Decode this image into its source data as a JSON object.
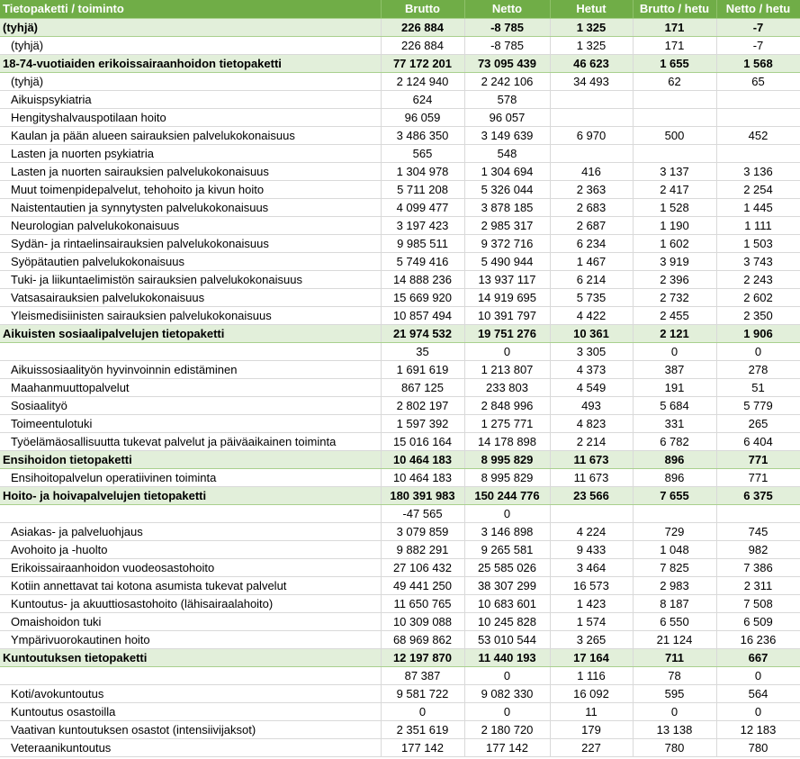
{
  "headers": [
    "Tietopaketti / toiminto",
    "Brutto",
    "Netto",
    "Hetut",
    "Brutto / hetu",
    "Netto / hetu"
  ],
  "rows": [
    {
      "group": true,
      "cells": [
        "(tyhjä)",
        "226 884",
        "-8 785",
        "1 325",
        "171",
        "-7"
      ]
    },
    {
      "group": false,
      "cells": [
        "(tyhjä)",
        "226 884",
        "-8 785",
        "1 325",
        "171",
        "-7"
      ]
    },
    {
      "group": true,
      "cells": [
        "18-74-vuotiaiden erikoissairaanhoidon tietopaketti",
        "77 172 201",
        "73 095 439",
        "46 623",
        "1 655",
        "1 568"
      ]
    },
    {
      "group": false,
      "cells": [
        "(tyhjä)",
        "2 124 940",
        "2 242 106",
        "34 493",
        "62",
        "65"
      ]
    },
    {
      "group": false,
      "cells": [
        "Aikuispsykiatria",
        "624",
        "578",
        "",
        "",
        ""
      ]
    },
    {
      "group": false,
      "cells": [
        "Hengityshalvauspotilaan hoito",
        "96 059",
        "96 057",
        "",
        "",
        ""
      ]
    },
    {
      "group": false,
      "cells": [
        "Kaulan ja pään alueen sairauksien palvelukokonaisuus",
        "3 486 350",
        "3 149 639",
        "6 970",
        "500",
        "452"
      ]
    },
    {
      "group": false,
      "cells": [
        "Lasten ja nuorten psykiatria",
        "565",
        "548",
        "",
        "",
        ""
      ]
    },
    {
      "group": false,
      "cells": [
        "Lasten ja nuorten sairauksien palvelukokonaisuus",
        "1 304 978",
        "1 304 694",
        "416",
        "3 137",
        "3 136"
      ]
    },
    {
      "group": false,
      "cells": [
        "Muut toimenpidepalvelut, tehohoito ja kivun hoito",
        "5 711 208",
        "5 326 044",
        "2 363",
        "2 417",
        "2 254"
      ]
    },
    {
      "group": false,
      "cells": [
        "Naistentautien ja synnytysten palvelukokonaisuus",
        "4 099 477",
        "3 878 185",
        "2 683",
        "1 528",
        "1 445"
      ]
    },
    {
      "group": false,
      "cells": [
        "Neurologian palvelukokonaisuus",
        "3 197 423",
        "2 985 317",
        "2 687",
        "1 190",
        "1 111"
      ]
    },
    {
      "group": false,
      "cells": [
        "Sydän- ja rintaelinsairauksien palvelukokonaisuus",
        "9 985 511",
        "9 372 716",
        "6 234",
        "1 602",
        "1 503"
      ]
    },
    {
      "group": false,
      "cells": [
        "Syöpätautien palvelukokonaisuus",
        "5 749 416",
        "5 490 944",
        "1 467",
        "3 919",
        "3 743"
      ]
    },
    {
      "group": false,
      "cells": [
        "Tuki- ja liikuntaelimistön sairauksien palvelukokonaisuus",
        "14 888 236",
        "13 937 117",
        "6 214",
        "2 396",
        "2 243"
      ]
    },
    {
      "group": false,
      "cells": [
        "Vatsasairauksien palvelukokonaisuus",
        "15 669 920",
        "14 919 695",
        "5 735",
        "2 732",
        "2 602"
      ]
    },
    {
      "group": false,
      "cells": [
        "Yleismedisiinisten sairauksien palvelukokonaisuus",
        "10 857 494",
        "10 391 797",
        "4 422",
        "2 455",
        "2 350"
      ]
    },
    {
      "group": true,
      "cells": [
        "Aikuisten sosiaalipalvelujen tietopaketti",
        "21 974 532",
        "19 751 276",
        "10 361",
        "2 121",
        "1 906"
      ]
    },
    {
      "group": false,
      "cells": [
        "",
        "35",
        "0",
        "3 305",
        "0",
        "0"
      ]
    },
    {
      "group": false,
      "cells": [
        "Aikuissosiaalityön hyvinvoinnin edistäminen",
        "1 691 619",
        "1 213 807",
        "4 373",
        "387",
        "278"
      ]
    },
    {
      "group": false,
      "cells": [
        "Maahanmuuttopalvelut",
        "867 125",
        "233 803",
        "4 549",
        "191",
        "51"
      ]
    },
    {
      "group": false,
      "cells": [
        "Sosiaalityö",
        "2 802 197",
        "2 848 996",
        "493",
        "5 684",
        "5 779"
      ]
    },
    {
      "group": false,
      "cells": [
        "Toimeentulotuki",
        "1 597 392",
        "1 275 771",
        "4 823",
        "331",
        "265"
      ]
    },
    {
      "group": false,
      "cells": [
        "Työelämäosallisuutta tukevat palvelut ja päiväaikainen toiminta",
        "15 016 164",
        "14 178 898",
        "2 214",
        "6 782",
        "6 404"
      ]
    },
    {
      "group": true,
      "cells": [
        "Ensihoidon tietopaketti",
        "10 464 183",
        "8 995 829",
        "11 673",
        "896",
        "771"
      ]
    },
    {
      "group": false,
      "cells": [
        "Ensihoitopalvelun operatiivinen toiminta",
        "10 464 183",
        "8 995 829",
        "11 673",
        "896",
        "771"
      ]
    },
    {
      "group": true,
      "cells": [
        "Hoito- ja hoivapalvelujen tietopaketti",
        "180 391 983",
        "150 244 776",
        "23 566",
        "7 655",
        "6 375"
      ]
    },
    {
      "group": false,
      "cells": [
        "",
        "-47 565",
        "0",
        "",
        "",
        ""
      ]
    },
    {
      "group": false,
      "cells": [
        "Asiakas- ja palveluohjaus",
        "3 079 859",
        "3 146 898",
        "4 224",
        "729",
        "745"
      ]
    },
    {
      "group": false,
      "cells": [
        "Avohoito ja -huolto",
        "9 882 291",
        "9 265 581",
        "9 433",
        "1 048",
        "982"
      ]
    },
    {
      "group": false,
      "cells": [
        "Erikoissairaanhoidon vuodeosastohoito",
        "27 106 432",
        "25 585 026",
        "3 464",
        "7 825",
        "7 386"
      ]
    },
    {
      "group": false,
      "cells": [
        "Kotiin annettavat tai kotona asumista tukevat palvelut",
        "49 441 250",
        "38 307 299",
        "16 573",
        "2 983",
        "2 311"
      ]
    },
    {
      "group": false,
      "cells": [
        "Kuntoutus- ja akuuttiosastohoito (lähisairaalahoito)",
        "11 650 765",
        "10 683 601",
        "1 423",
        "8 187",
        "7 508"
      ]
    },
    {
      "group": false,
      "cells": [
        "Omaishoidon tuki",
        "10 309 088",
        "10 245 828",
        "1 574",
        "6 550",
        "6 509"
      ]
    },
    {
      "group": false,
      "cells": [
        "Ympärivuorokautinen hoito",
        "68 969 862",
        "53 010 544",
        "3 265",
        "21 124",
        "16 236"
      ]
    },
    {
      "group": true,
      "cells": [
        "Kuntoutuksen tietopaketti",
        "12 197 870",
        "11 440 193",
        "17 164",
        "711",
        "667"
      ]
    },
    {
      "group": false,
      "cells": [
        "",
        "87 387",
        "0",
        "1 116",
        "78",
        "0"
      ]
    },
    {
      "group": false,
      "cells": [
        "Koti/avokuntoutus",
        "9 581 722",
        "9 082 330",
        "16 092",
        "595",
        "564"
      ]
    },
    {
      "group": false,
      "cells": [
        "Kuntoutus osastoilla",
        "0",
        "0",
        "11",
        "0",
        "0"
      ]
    },
    {
      "group": false,
      "cells": [
        "Vaativan kuntoutuksen osastot (intensiivijaksot)",
        "2 351 619",
        "2 180 720",
        "179",
        "13 138",
        "12 183"
      ]
    },
    {
      "group": false,
      "cells": [
        "Veteraanikuntoutus",
        "177 142",
        "177 142",
        "227",
        "780",
        "780"
      ]
    }
  ]
}
